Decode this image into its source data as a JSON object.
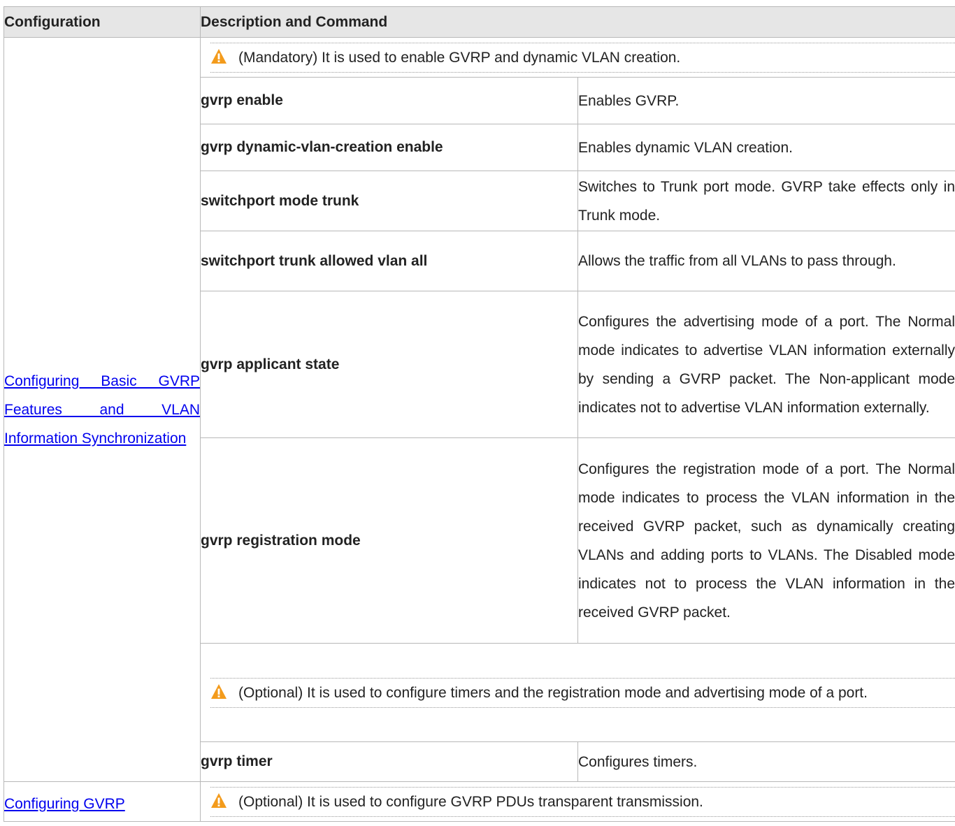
{
  "header": {
    "col1": "Configuration",
    "col2": "Description and Command"
  },
  "groups": [
    {
      "config_link": "Configuring Basic GVRP Features and VLAN Information Synchronization",
      "notes": {
        "mandatory": "(Mandatory) It is used to enable GVRP and dynamic VLAN creation.",
        "optional": "(Optional) It is used to configure timers and the registration mode and advertising mode of a port."
      },
      "rows": [
        {
          "command": "gvrp enable",
          "description": "Enables GVRP."
        },
        {
          "command": "gvrp dynamic-vlan-creation enable",
          "description": "Enables dynamic VLAN creation."
        },
        {
          "command": "switchport mode trunk",
          "description": "Switches to Trunk port mode. GVRP take effects only in Trunk mode."
        },
        {
          "command": "switchport trunk allowed vlan all",
          "description": "Allows the traffic from all VLANs to pass through."
        },
        {
          "command": "gvrp applicant state",
          "description": "Configures the advertising mode of a port. The Normal mode indicates to advertise VLAN information externally by sending a GVRP packet. The Non-applicant mode indicates not to advertise VLAN information externally."
        },
        {
          "command": "gvrp registration mode",
          "description": "Configures the registration mode of a port. The Normal mode indicates to process the VLAN information in the received GVRP packet, such as dynamically creating VLANs and adding ports to VLANs. The Disabled mode indicates not to process the VLAN information in the received GVRP packet."
        },
        {
          "command": "gvrp timer",
          "description": "Configures timers."
        }
      ]
    },
    {
      "config_link": "Configuring GVRP",
      "notes": {
        "optional": "(Optional) It is used to configure GVRP PDUs transparent transmission."
      }
    }
  ],
  "icons": {
    "warning": "warning-triangle-icon",
    "warning_fill": "#f39b1c",
    "warning_mark": "#ffffff"
  },
  "colors": {
    "header_bg": "#e6e6e6",
    "link": "#0000ee",
    "border": "#b8b8b8"
  }
}
